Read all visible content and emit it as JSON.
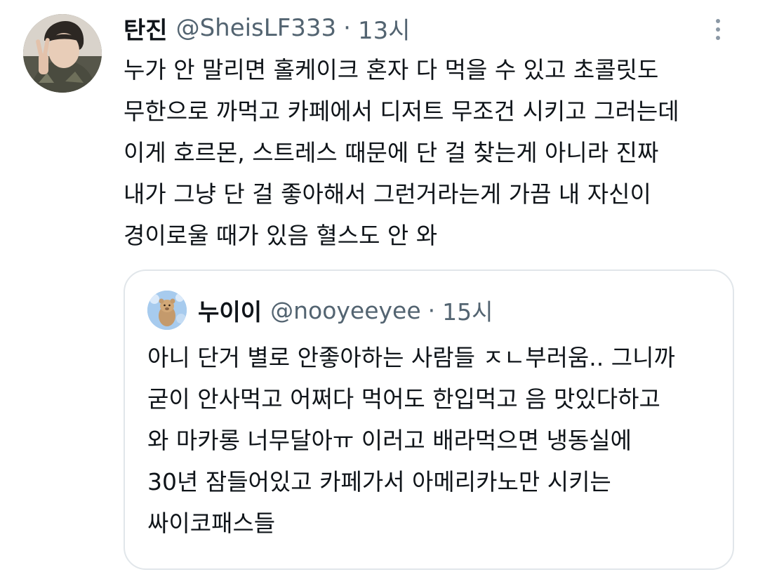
{
  "tweet": {
    "display_name": "탄진",
    "handle": "@SheisLF333",
    "separator": "·",
    "time": "13시",
    "text_lines": [
      "누가 안 말리면 홀케이크 혼자 다 먹을 수 있고 초콜릿도",
      "무한으로 까먹고 카페에서 디저트 무조건 시키고 그러는데",
      "이게 호르몬, 스트레스 때문에 단 걸 찾는게 아니라 진짜",
      "내가 그냥 단 걸 좋아해서 그런거라는게 가끔 내 자신이",
      "경이로울 때가 있음 혈스도 안 와"
    ]
  },
  "quote": {
    "display_name": "누이이",
    "handle": "@nooyeeyee",
    "separator": "·",
    "time": "15시",
    "text_lines": [
      "아니 단거 별로 안좋아하는 사람들 ㅈㄴ부러움.. 그니까",
      "굳이 안사먹고 어쩌다 먹어도 한입먹고 음 맛있다하고",
      "와 마카롱 너무달아ㅠ 이러고 배라먹으면 냉동실에",
      "30년 잠들어있고 카페가서 아메리카노만 시키는",
      "싸이코패스들"
    ]
  },
  "icons": {
    "more": "more-vertical-icon",
    "avatar": "avatar",
    "quote_avatar": "quote-avatar"
  },
  "colors": {
    "text": "#0f1419",
    "secondary": "#536471",
    "border": "#e1e6ea"
  }
}
